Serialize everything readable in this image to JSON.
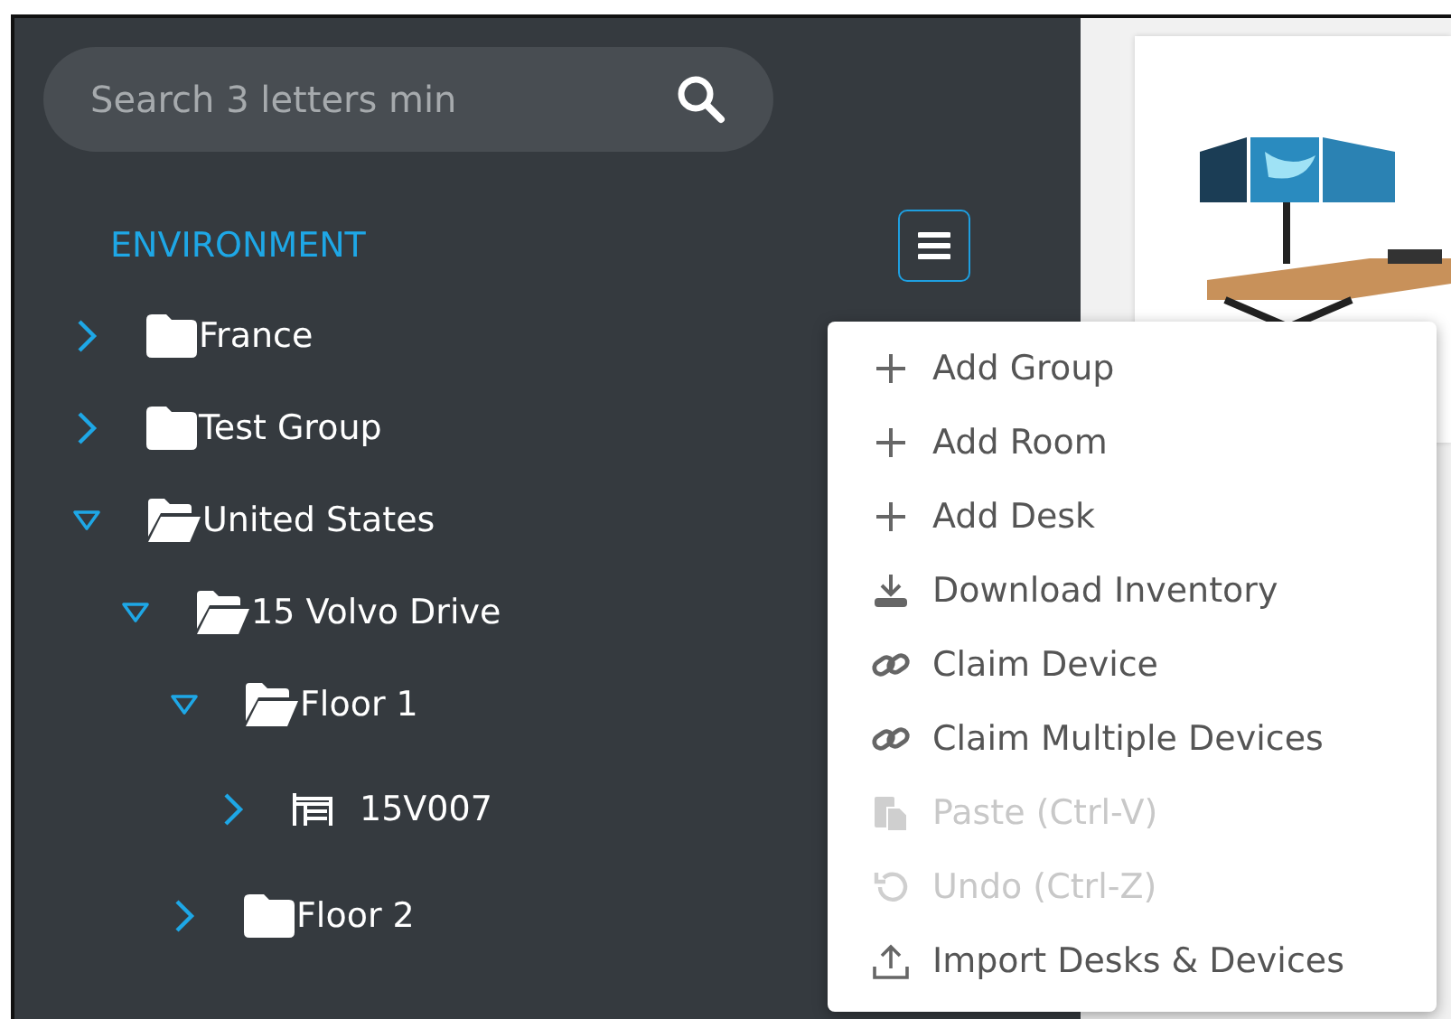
{
  "search": {
    "placeholder": "Search 3 letters min"
  },
  "section": {
    "title": "ENVIRONMENT"
  },
  "tree": [
    {
      "label": "France",
      "kind": "folder",
      "expanded": false
    },
    {
      "label": "Test Group",
      "kind": "folder",
      "expanded": false
    },
    {
      "label": "United States",
      "kind": "folder",
      "expanded": true,
      "children": [
        {
          "label": "15 Volvo Drive",
          "kind": "folder",
          "expanded": true,
          "children": [
            {
              "label": "Floor 1",
              "kind": "folder",
              "expanded": true,
              "children": [
                {
                  "label": "15V007",
                  "kind": "desk",
                  "expanded": false
                }
              ]
            },
            {
              "label": "Floor 2",
              "kind": "folder",
              "expanded": false
            }
          ]
        }
      ]
    }
  ],
  "menu": [
    {
      "label": "Add Group",
      "kind": "plus",
      "disabled": false
    },
    {
      "label": "Add Room",
      "kind": "plus",
      "disabled": false
    },
    {
      "label": "Add Desk",
      "kind": "plus",
      "disabled": false
    },
    {
      "label": "Download Inventory",
      "kind": "download",
      "disabled": false
    },
    {
      "label": "Claim Device",
      "kind": "link",
      "disabled": false
    },
    {
      "label": "Claim Multiple Devices",
      "kind": "link",
      "disabled": false
    },
    {
      "label": "Paste (Ctrl-V)",
      "kind": "paste",
      "disabled": true
    },
    {
      "label": "Undo (Ctrl-Z)",
      "kind": "undo",
      "disabled": true
    },
    {
      "label": "Import Desks & Devices",
      "kind": "upload",
      "disabled": false
    }
  ]
}
